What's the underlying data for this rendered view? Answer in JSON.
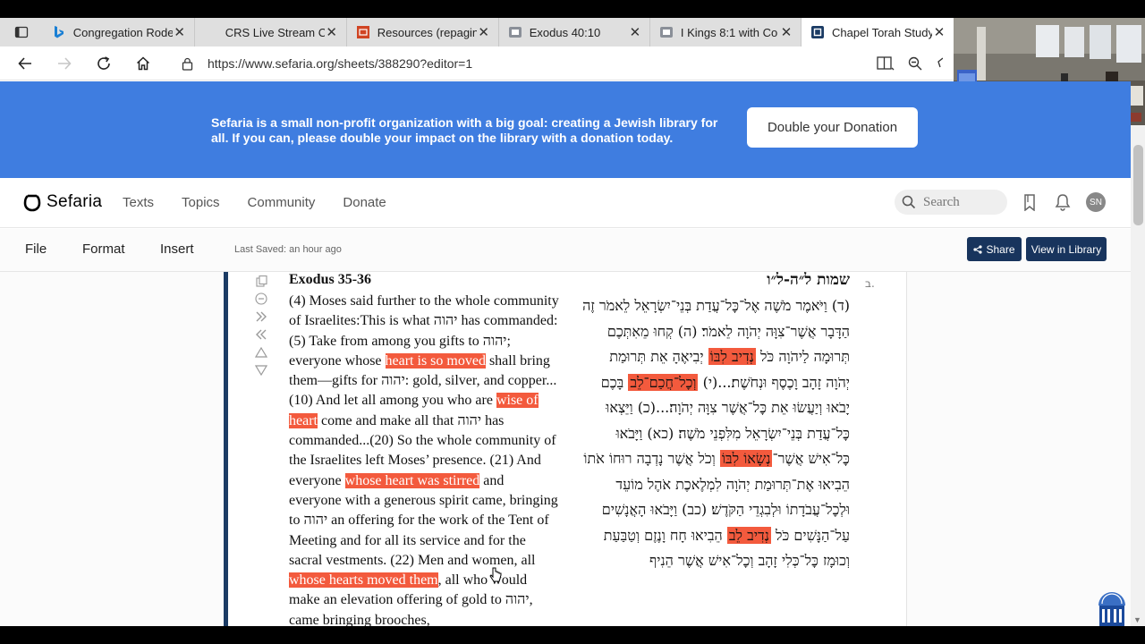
{
  "browser": {
    "tabs": [
      {
        "label": "Congregation Rode",
        "icon": "bing-icon"
      },
      {
        "label": "CRS Live Stream Co",
        "icon": "blank-icon"
      },
      {
        "label": "Resources (repagin",
        "icon": "slides-icon"
      },
      {
        "label": "Exodus 40:10",
        "icon": "sefaria-tab-icon"
      },
      {
        "label": "I Kings 8:1 with Co",
        "icon": "sefaria-tab-icon"
      },
      {
        "label": "Chapel Torah Study",
        "icon": "sefaria-logo-icon"
      }
    ],
    "url": "https://www.sefaria.org/sheets/388290?editor=1"
  },
  "banner": {
    "text": "Sefaria is a small non-profit organization with a big goal: creating a Jewish library for all. If you can, please double your impact on the library with a donation today.",
    "button": "Double your Donation",
    "color": "#3f7de0"
  },
  "header": {
    "logo": "Sefaria",
    "nav": [
      "Texts",
      "Topics",
      "Community",
      "Donate"
    ],
    "search_placeholder": "Search",
    "avatar": "SN"
  },
  "toolbar": {
    "menus": [
      "File",
      "Format",
      "Insert"
    ],
    "saved": "Last Saved: an hour ago",
    "share": "Share",
    "view": "View in Library",
    "button_color": "#18345d"
  },
  "source": {
    "en_ref": "Exodus 35-36",
    "he_ref": "שמות ל״ה-ל״ו",
    "item_number": "ב.",
    "highlight_color": "#f35a3d",
    "en": [
      {
        "t": "(4) Moses said further to the whole community of Israelites:This is what יהוה has commanded: (5) Take from among you gifts to יהוה; everyone whose "
      },
      {
        "t": "heart is so moved",
        "hl": true
      },
      {
        "t": " shall bring them—gifts for יהוה: gold, silver, and copper...(10) And let all among you who are "
      },
      {
        "t": "wise of heart",
        "hl": true
      },
      {
        "t": " come and make all that יהוה has commanded...(20) So the whole community of the Israelites left Moses’ presence. (21) And everyone "
      },
      {
        "t": "whose heart was stirred",
        "hl": true
      },
      {
        "t": " and everyone with a generous spirit came, bringing to יהוה an offering for the work of the Tent of Meeting and for all its service and for the sacral vestments. (22) Men and women, all "
      },
      {
        "t": "whose hearts moved them",
        "hl": true
      },
      {
        "t": ", all who would make an elevation offering of gold to יהוה, came bringing brooches,"
      }
    ],
    "he": [
      {
        "t": "(ד) וַיֹּאמֶר מֹשֶׁה אֶל־כׇּל־עֲדַת בְּנֵי־יִשְׂרָאֵל לֵאמֹר זֶה הַדָּבָר אֲשֶׁר־צִוָּה יְהֹוָה לֵאמֹר׃ (ה) קְחוּ מֵאִתְּכֶם תְּרוּמָה לַיהֹוָה כֹּל "
      },
      {
        "t": "נְדִיב לִבּוֹ",
        "hl": true
      },
      {
        "t": " יְבִיאֶהָ אֵת תְּרוּמַת יְהֹוָה זָהָב וָכֶסֶף וּנְחֹשֶׁת׃...(י) "
      },
      {
        "t": "וְכׇל־חֲכַם־לֵב",
        "hl": true
      },
      {
        "t": " בָּכֶם יָבֹאוּ וְיַעֲשׂוּ אֵת כׇּל־אֲשֶׁר צִוָּה יְהֹוָה׃...(כ) וַיֵּצְאוּ כׇּל־עֲדַת בְּנֵי־יִשְׂרָאֵל מִלִּפְנֵי מֹשֶׁה׃ (כא) וַיָּבֹאוּ כׇּל־אִישׁ אֲשֶׁר־"
      },
      {
        "t": "נְשָׂאוֹ לִבּוֹ",
        "hl": true
      },
      {
        "t": " וְכֹל אֲשֶׁר נָדְבָה רוּחוֹ אֹתוֹ הֵבִיאוּ אֶת־תְּרוּמַת יְהֹוָה לִמְלֶאכֶת אֹהֶל מוֹעֵד וּלְכׇל־עֲבֹדָתוֹ וּלְבִגְדֵי הַקֹּדֶשׁ׃ (כב) וַיָּבֹאוּ הָאֲנָשִׁים עַל־הַנָּשִׁים כֹּל "
      },
      {
        "t": "נְדִיב לֵב",
        "hl": true
      },
      {
        "t": " הֵבִיאוּ חָח וָנֶזֶם וְטַבַּעַת וְכוּמָז כׇּל־כְּלִי זָהָב וְכׇל־אִישׁ אֲשֶׁר הֵנִיף"
      }
    ]
  }
}
